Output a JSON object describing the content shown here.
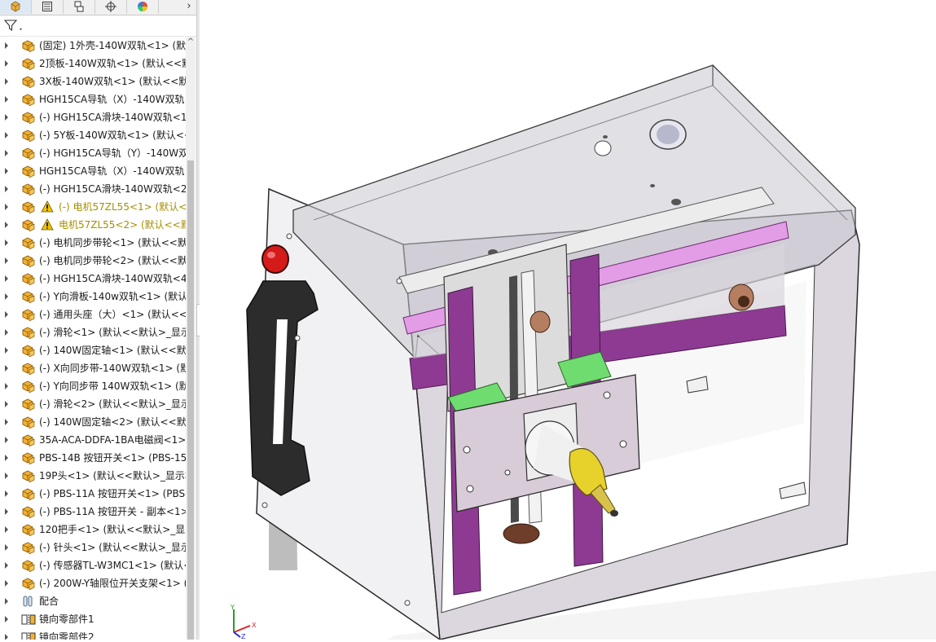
{
  "panel_tabs": [
    {
      "name": "featuremanager-tab",
      "icon": "featuremanager-icon",
      "active": true
    },
    {
      "name": "property-manager-tab",
      "icon": "property-manager-icon",
      "active": false
    },
    {
      "name": "configuration-manager-tab",
      "icon": "configuration-manager-icon",
      "active": false
    },
    {
      "name": "dimxpert-tab",
      "icon": "dimxpert-icon",
      "active": false
    },
    {
      "name": "display-manager-tab",
      "icon": "display-manager-icon",
      "active": false
    }
  ],
  "more_tabs_glyph": "›",
  "scroll_up_glyph": "^",
  "tree": [
    {
      "label": "(固定) 1外壳-140W双轨<1> (默认",
      "icon": "part-icon",
      "warning": false
    },
    {
      "label": "2顶板-140W双轨<1> (默认<<默",
      "icon": "part-icon",
      "warning": false
    },
    {
      "label": "3X板-140W双轨<1> (默认<<默",
      "icon": "part-icon",
      "warning": false
    },
    {
      "label": "HGH15CA导轨（X）-140W双轨",
      "icon": "part-icon",
      "warning": false
    },
    {
      "label": "(-) HGH15CA滑块-140W双轨<1",
      "icon": "part-icon",
      "warning": false
    },
    {
      "label": "(-) 5Y板-140W双轨<1> (默认<<",
      "icon": "part-icon",
      "warning": false
    },
    {
      "label": "(-) HGH15CA导轨（Y）-140W双",
      "icon": "part-icon",
      "warning": false
    },
    {
      "label": "HGH15CA导轨（X）-140W双轨",
      "icon": "part-icon",
      "warning": false
    },
    {
      "label": "(-) HGH15CA滑块-140W双轨<2",
      "icon": "part-icon",
      "warning": false
    },
    {
      "label": "(-) 电机57ZL55<1> (默认<<",
      "icon": "part-icon",
      "warning": true
    },
    {
      "label": "电机57ZL55<2> (默认<<默",
      "icon": "part-icon",
      "warning": true
    },
    {
      "label": "(-) 电机同步带轮<1> (默认<<默",
      "icon": "part-icon",
      "warning": false
    },
    {
      "label": "(-) 电机同步带轮<2> (默认<<默",
      "icon": "part-icon",
      "warning": false
    },
    {
      "label": "(-) HGH15CA滑块-140W双轨<4",
      "icon": "part-icon",
      "warning": false
    },
    {
      "label": "(-) Y向滑板-140w双轨<1> (默认",
      "icon": "part-icon",
      "warning": false
    },
    {
      "label": "(-) 通用头座（大）<1> (默认<<",
      "icon": "part-icon",
      "warning": false
    },
    {
      "label": "(-) 滑轮<1> (默认<<默认>_显示",
      "icon": "part-icon",
      "warning": false
    },
    {
      "label": "(-) 140W固定轴<1> (默认<<默认",
      "icon": "part-icon",
      "warning": false
    },
    {
      "label": "(-) X向同步带-140W双轨<1> (默",
      "icon": "part-icon",
      "warning": false
    },
    {
      "label": "(-) Y向同步带 140W双轨<1> (默",
      "icon": "part-icon",
      "warning": false
    },
    {
      "label": "(-) 滑轮<2> (默认<<默认>_显示",
      "icon": "part-icon",
      "warning": false
    },
    {
      "label": "(-) 140W固定轴<2> (默认<<默认",
      "icon": "part-icon",
      "warning": false
    },
    {
      "label": "35A-ACA-DDFA-1BA电磁阀<1>",
      "icon": "part-icon",
      "warning": false
    },
    {
      "label": "PBS-14B 按钮开关<1> (PBS-15A",
      "icon": "part-icon",
      "warning": false
    },
    {
      "label": "19P头<1> (默认<<默认>_显示状",
      "icon": "part-icon",
      "warning": false
    },
    {
      "label": "(-) PBS-11A 按钮开关<1> (PBS-",
      "icon": "part-icon",
      "warning": false
    },
    {
      "label": "(-) PBS-11A 按钮开关 - 副本<1>",
      "icon": "part-icon",
      "warning": false
    },
    {
      "label": "120把手<1> (默认<<默认>_显示",
      "icon": "part-icon",
      "warning": false
    },
    {
      "label": "(-) 针头<1> (默认<<默认>_显示",
      "icon": "part-icon",
      "warning": false
    },
    {
      "label": "(-) 传感器TL-W3MC1<1> (默认<",
      "icon": "part-icon",
      "warning": false
    },
    {
      "label": "(-) 200W-Y轴限位开关支架<1> (",
      "icon": "part-icon",
      "warning": false
    },
    {
      "label": "配合",
      "icon": "mates-icon",
      "warning": false
    },
    {
      "label": "镜向零部件1",
      "icon": "mirror-component-icon",
      "warning": false
    },
    {
      "label": "镜向零部件2",
      "icon": "mirror-component-icon",
      "warning": false
    }
  ],
  "triad": {
    "x_label": "X",
    "y_label": "Y",
    "z_label": "Z"
  },
  "colors": {
    "part_icon": "#f2b233",
    "warning": "#f0c400",
    "warning_text": "#a68f00",
    "rail_purple": "#8e3a93",
    "rail_light": "#e39ce6",
    "green_block": "#6fdc6f",
    "nozzle_yellow": "#e7d22c"
  }
}
